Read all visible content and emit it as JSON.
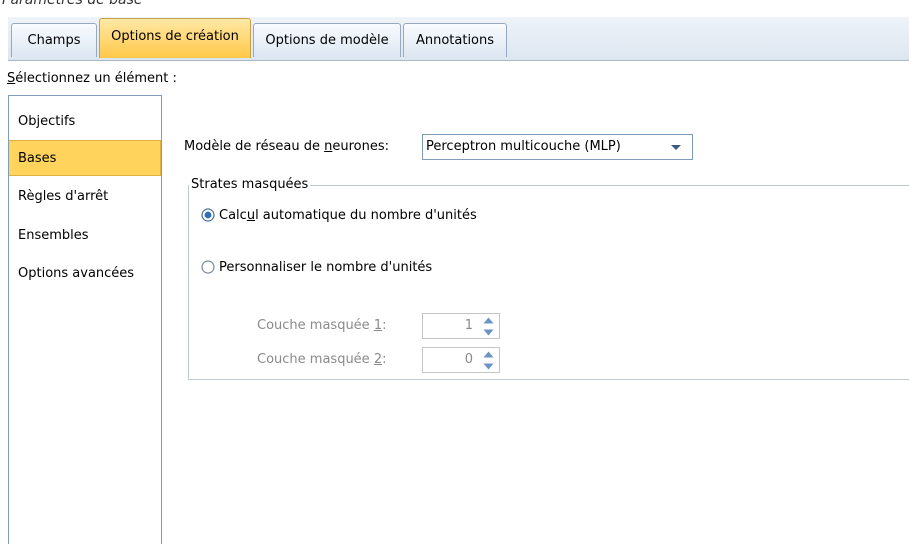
{
  "caption": "Paramètres de base",
  "tabs": [
    {
      "label": "Champs",
      "active": false
    },
    {
      "label": "Options de création",
      "active": true
    },
    {
      "label": "Options de modèle",
      "active": false
    },
    {
      "label": "Annotations",
      "active": false
    }
  ],
  "select_element": {
    "label_first": "S",
    "label_rest": "électionnez un élément :"
  },
  "nav": {
    "items": [
      {
        "label": "Objectifs",
        "selected": false
      },
      {
        "label": "Bases",
        "selected": true
      },
      {
        "label": "Règles d'arrêt",
        "selected": false
      },
      {
        "label": "Ensembles",
        "selected": false
      },
      {
        "label": "Options avancées",
        "selected": false
      }
    ]
  },
  "model": {
    "label_a": "Modèle de réseau de ",
    "label_u": "n",
    "label_b": "eurones:",
    "value": "Perceptron multicouche (MLP)"
  },
  "hidden_layers": {
    "title": "Strates masquées",
    "auto": {
      "text_a": "Calc",
      "text_u": "u",
      "text_b": "l automatique du nombre d'unités",
      "checked": true
    },
    "custom": {
      "text": "Personnaliser le nombre d'unités",
      "checked": false
    },
    "layer1": {
      "label_a": "Couche masquée ",
      "label_u": "1",
      "label_b": ":",
      "value": "1"
    },
    "layer2": {
      "label_a": "Couche masquée ",
      "label_u": "2",
      "label_b": ":",
      "value": "0"
    }
  },
  "colors": {
    "active_tab": "#ffc848",
    "selected_nav": "#ffd35c",
    "accent_blue": "#2f6fb8"
  }
}
